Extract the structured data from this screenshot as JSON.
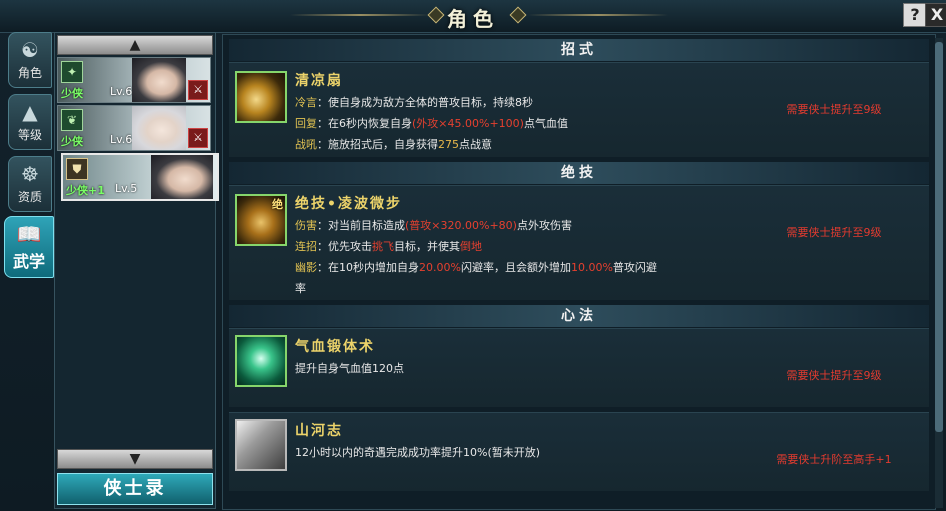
{
  "window": {
    "title": "角色",
    "help_label": "?",
    "close_label": "X"
  },
  "nav_tabs": [
    {
      "label": "角色",
      "icon": "character-icon"
    },
    {
      "label": "等级",
      "icon": "level-icon"
    },
    {
      "label": "资质",
      "icon": "aptitude-icon"
    },
    {
      "label": "武学",
      "icon": "martial-arts-icon",
      "active": true
    }
  ],
  "characters": [
    {
      "rank": "少侠",
      "level": "Lv.6",
      "badge_icon": "star-badge-icon"
    },
    {
      "rank": "少侠",
      "level": "Lv.6",
      "badge_icon": "leaf-badge-icon"
    },
    {
      "rank": "少侠+1",
      "level": "Lv.5",
      "badge_icon": "shield-badge-icon",
      "selected": true
    }
  ],
  "record_button": "侠士录",
  "sections": {
    "moves": {
      "header": "招式",
      "skill": {
        "name": "清凉扇",
        "l1_key": "冷言",
        "l1_text": "：使自身成为敌方全体的普攻目标，持续8秒",
        "l2_key": "回复",
        "l2_pre": "：在6秒内恢复自身",
        "l2_hl": "(外攻×45.00%+100)",
        "l2_post": "点气血值",
        "l3_key": "战吼",
        "l3_pre": "：施放招式后，自身获得",
        "l3_hl": "275",
        "l3_post": "点战意",
        "requirement": "需要侠士提升至9级"
      }
    },
    "ultimate": {
      "header": "绝技",
      "skill": {
        "name": "绝技•凌波微步",
        "badge": "绝",
        "l1_key": "伤害",
        "l1_pre": "：对当前目标造成",
        "l1_hl": "(普攻×320.00%+80)",
        "l1_post": "点外攻伤害",
        "l2_key": "连招",
        "l2_pre": "：优先攻击",
        "l2_hl1": "挑飞",
        "l2_mid": "目标，并使其",
        "l2_hl2": "倒地",
        "l3_key": "幽影",
        "l3_pre": "：在10秒内增加自身",
        "l3_hl1": "20.00%",
        "l3_mid": "闪避率，且会额外增加",
        "l3_hl2": "10.00%",
        "l3_post": "普攻闪避",
        "l4": "率",
        "requirement": "需要侠士提升至9级"
      }
    },
    "mental": {
      "header": "心法",
      "skills": [
        {
          "name": "气血锻体术",
          "desc": "提升自身气血值120点",
          "requirement": "需要侠士提升至9级"
        },
        {
          "name": "山河志",
          "desc": "12小时以内的奇遇完成成功率提升10%(暂未开放)",
          "requirement": "需要侠士升阶至高手+1"
        }
      ]
    }
  }
}
